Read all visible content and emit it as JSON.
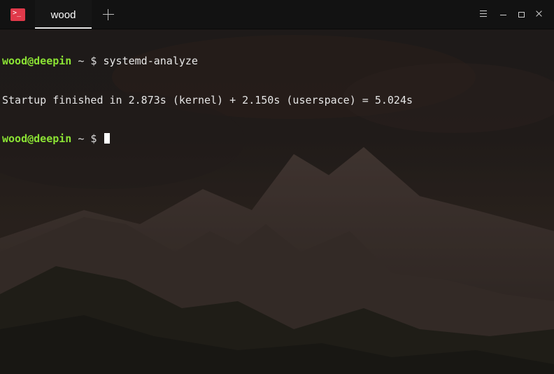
{
  "window": {
    "tab_title": "wood",
    "app_icon_glyph": ">_",
    "icons": {
      "app": "terminal-icon",
      "add_tab": "plus-icon",
      "menu": "hamburger-menu-icon",
      "minimize": "minimize-icon",
      "maximize": "maximize-icon",
      "close": "close-icon"
    }
  },
  "colors": {
    "prompt_user": "#8be234",
    "app_icon_bg": "#e0394a",
    "titlebar_bg": "#121212"
  },
  "terminal": {
    "lines": [
      {
        "user_host": "wood@deepin",
        "prompt_sym": " ~ $ ",
        "command": "systemd-analyze"
      },
      {
        "output": "Startup finished in 2.873s (kernel) + 2.150s (userspace) = 5.024s"
      },
      {
        "user_host": "wood@deepin",
        "prompt_sym": " ~ $ ",
        "command": ""
      }
    ]
  }
}
